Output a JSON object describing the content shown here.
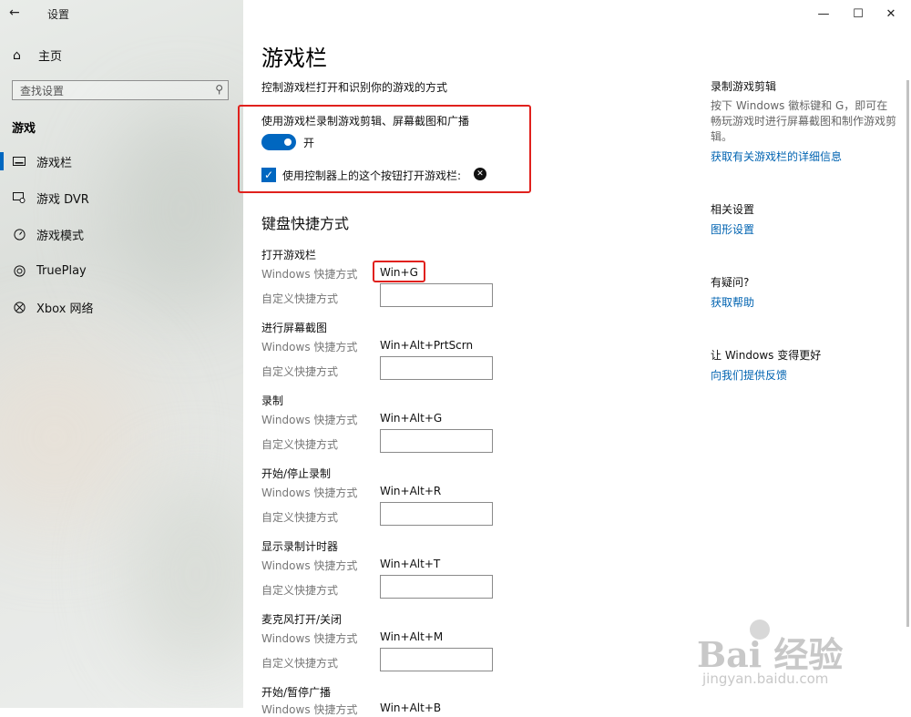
{
  "window": {
    "app_title": "设置",
    "controls": {
      "minimize": "—",
      "maximize": "☐",
      "close": "✕"
    }
  },
  "sidebar": {
    "back_icon": "arrow-left-icon",
    "home_label": "主页",
    "search_placeholder": "查找设置",
    "section": "游戏",
    "items": [
      {
        "label": "游戏栏",
        "icon": "game-bar-icon",
        "active": true
      },
      {
        "label": "游戏 DVR",
        "icon": "dvr-icon",
        "active": false
      },
      {
        "label": "游戏模式",
        "icon": "game-mode-icon",
        "active": false
      },
      {
        "label": "TruePlay",
        "icon": "trueplay-icon",
        "active": false
      },
      {
        "label": "Xbox 网络",
        "icon": "xbox-icon",
        "active": false
      }
    ]
  },
  "main": {
    "title": "游戏栏",
    "description": "控制游戏栏打开和识别你的游戏的方式",
    "record_option_label": "使用游戏栏录制游戏剪辑、屏幕截图和广播",
    "toggle_state": "开",
    "controller_checkbox_label": "使用控制器上的这个按钮打开游戏栏:",
    "keyboard_title": "键盘快捷方式",
    "windows_shortcut_label": "Windows 快捷方式",
    "custom_shortcut_label": "自定义快捷方式",
    "shortcuts": [
      {
        "title": "打开游戏栏",
        "value": "Win+G"
      },
      {
        "title": "进行屏幕截图",
        "value": "Win+Alt+PrtScrn"
      },
      {
        "title": "录制",
        "value": "Win+Alt+G"
      },
      {
        "title": "开始/停止录制",
        "value": "Win+Alt+R"
      },
      {
        "title": "显示录制计时器",
        "value": "Win+Alt+T"
      },
      {
        "title": "麦克风打开/关闭",
        "value": "Win+Alt+M"
      },
      {
        "title": "开始/暂停广播",
        "value": "Win+Alt+B"
      }
    ]
  },
  "right_panel": {
    "record_heading": "录制游戏剪辑",
    "record_text": "按下 Windows 徽标键和 G，即可在畅玩游戏时进行屏幕截图和制作游戏剪辑。",
    "record_link": "获取有关游戏栏的详细信息",
    "related_heading": "相关设置",
    "related_link": "图形设置",
    "question_heading": "有疑问?",
    "question_link": "获取帮助",
    "feedback_heading": "让 Windows 变得更好",
    "feedback_link": "向我们提供反馈"
  },
  "watermark": {
    "main": "Bai 经验",
    "sub": "jingyan.baidu.com"
  },
  "colors": {
    "accent": "#0067c0",
    "link": "#0063b1",
    "highlight": "#e0211d"
  }
}
